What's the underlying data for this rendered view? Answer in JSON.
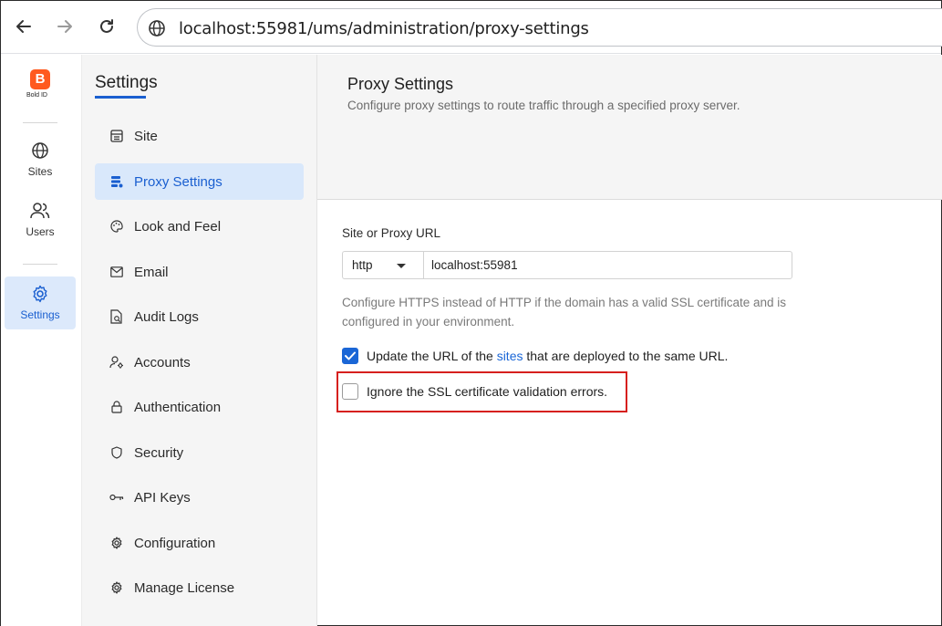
{
  "browser": {
    "url": "localhost:55981/ums/administration/proxy-settings",
    "back_icon": "arrow-left-icon",
    "forward_icon": "arrow-right-icon",
    "reload_icon": "reload-icon",
    "site_info_icon": "globe-icon"
  },
  "rail": {
    "logo_letter": "B",
    "logo_text": "Bold ID",
    "items": [
      {
        "label": "Sites",
        "icon": "globe-icon"
      },
      {
        "label": "Users",
        "icon": "users-icon"
      },
      {
        "label": "Settings",
        "icon": "gear-icon",
        "active": true
      }
    ]
  },
  "settings": {
    "title": "Settings",
    "items": [
      {
        "label": "Site",
        "icon": "site-icon"
      },
      {
        "label": "Proxy Settings",
        "icon": "proxy-icon",
        "active": true
      },
      {
        "label": "Look and Feel",
        "icon": "palette-icon"
      },
      {
        "label": "Email",
        "icon": "envelope-icon"
      },
      {
        "label": "Audit Logs",
        "icon": "audit-log-icon"
      },
      {
        "label": "Accounts",
        "icon": "accounts-icon"
      },
      {
        "label": "Authentication",
        "icon": "lock-icon"
      },
      {
        "label": "Security",
        "icon": "shield-icon"
      },
      {
        "label": "API Keys",
        "icon": "key-icon"
      },
      {
        "label": "Configuration",
        "icon": "gear-icon"
      },
      {
        "label": "Manage License",
        "icon": "gear-icon"
      }
    ]
  },
  "main": {
    "title": "Proxy Settings",
    "subtitle": "Configure proxy settings to route traffic through a specified proxy server.",
    "field_label": "Site or Proxy URL",
    "protocol_value": "http",
    "url_value": "localhost:55981",
    "help_text": "Configure HTTPS instead of HTTP if the domain has a valid SSL certificate and is configured in your environment.",
    "update_url": {
      "checked": true,
      "prefix": "Update the URL of the ",
      "link": "sites",
      "suffix": " that are deployed to the same URL."
    },
    "ignore_ssl": {
      "checked": false,
      "label": "Ignore the SSL certificate validation errors."
    }
  },
  "colors": {
    "accent": "#1a5fd0",
    "highlight": "#d6201e",
    "logo": "#ff5a1f"
  }
}
